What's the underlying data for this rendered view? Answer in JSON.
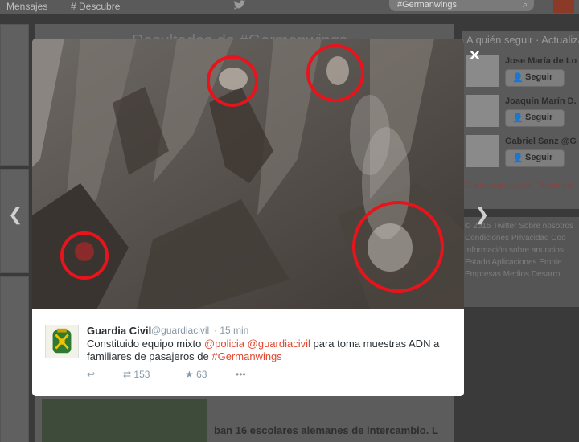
{
  "topbar": {
    "nav": [
      "Mensajes",
      "Descubre"
    ],
    "search_value": "#Germanwings"
  },
  "background": {
    "heading": "Resultados de #Germanwings",
    "snippet": "ban 16 escolares alemanes de intercambio. L"
  },
  "sidebar": {
    "title": "A quién seguir · Actualizar",
    "suggestions": [
      {
        "name": "Jose María de Lo",
        "follow_label": "Seguir"
      },
      {
        "name": "Joaquín Marín D.",
        "follow_label": "Seguir"
      },
      {
        "name": "Gabriel Sanz @G",
        "follow_label": "Seguir"
      }
    ],
    "links": "Cuentas populares · Encontrar",
    "footer": [
      "© 2015 Twitter  Sobre nosotros",
      "Condiciones  Privacidad  Coo",
      "Información sobre anuncios",
      "Estado  Aplicaciones  Emple",
      "Empresas  Medios  Desarrol"
    ]
  },
  "modal": {
    "close": "×",
    "tweet": {
      "name": "Guardia Civil",
      "handle": "@guardiacivil",
      "time": "· 15 min",
      "text_start": "Constituido equipo mixto ",
      "mention1": "@policia",
      "mention2": "@guardiacivil",
      "text_mid": " para toma muestras ADN a familiares de pasajeros de ",
      "hashtag": "#Germanwings",
      "retweets": "153",
      "favorites": "63"
    }
  },
  "colors": {
    "link": "#e0482f",
    "circle": "#e8141c"
  }
}
